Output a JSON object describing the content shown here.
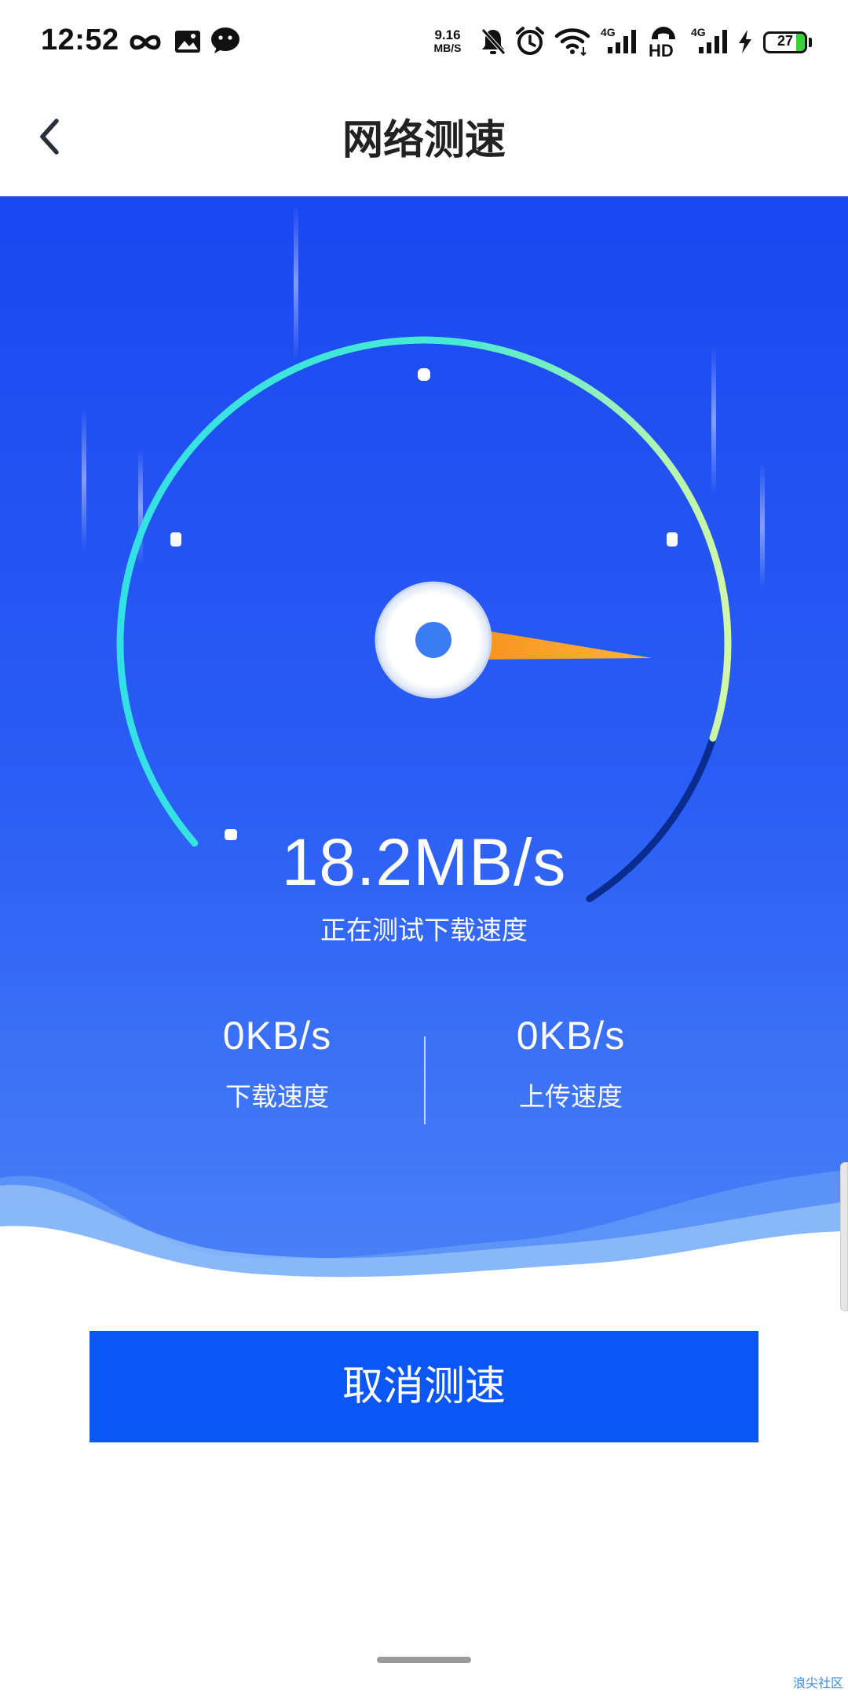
{
  "status_bar": {
    "time": "12:52",
    "net_speed_value": "9.16",
    "net_speed_unit": "MB/S",
    "network_label_1": "4G",
    "hd_label": "HD",
    "network_label_2": "4G",
    "battery_level": "27",
    "icons": [
      "infinity-icon",
      "gallery-icon",
      "wechat-icon",
      "mute-bell-icon",
      "alarm-icon",
      "wifi-icon",
      "signal-icon",
      "hd-call-icon",
      "signal-icon",
      "charging-icon",
      "battery-icon"
    ]
  },
  "app_bar": {
    "title": "网络测速",
    "back_icon": "chevron-left-icon"
  },
  "speed_test": {
    "current_speed": "18.2MB/s",
    "status": "正在测试下载速度",
    "gauge_progress": 0.86,
    "download": {
      "value": "0KB/s",
      "label": "下载速度"
    },
    "upload": {
      "value": "0KB/s",
      "label": "上传速度"
    }
  },
  "actions": {
    "cancel_label": "取消测速"
  },
  "watermark": "浪尖社区",
  "colors": {
    "hero_top": "#1a47f0",
    "hero_bottom": "#4a82f7",
    "gauge_start": "#33e0e6",
    "gauge_end": "#d2f7a6",
    "needle": "#f79a1e",
    "button": "#0a57f5"
  }
}
